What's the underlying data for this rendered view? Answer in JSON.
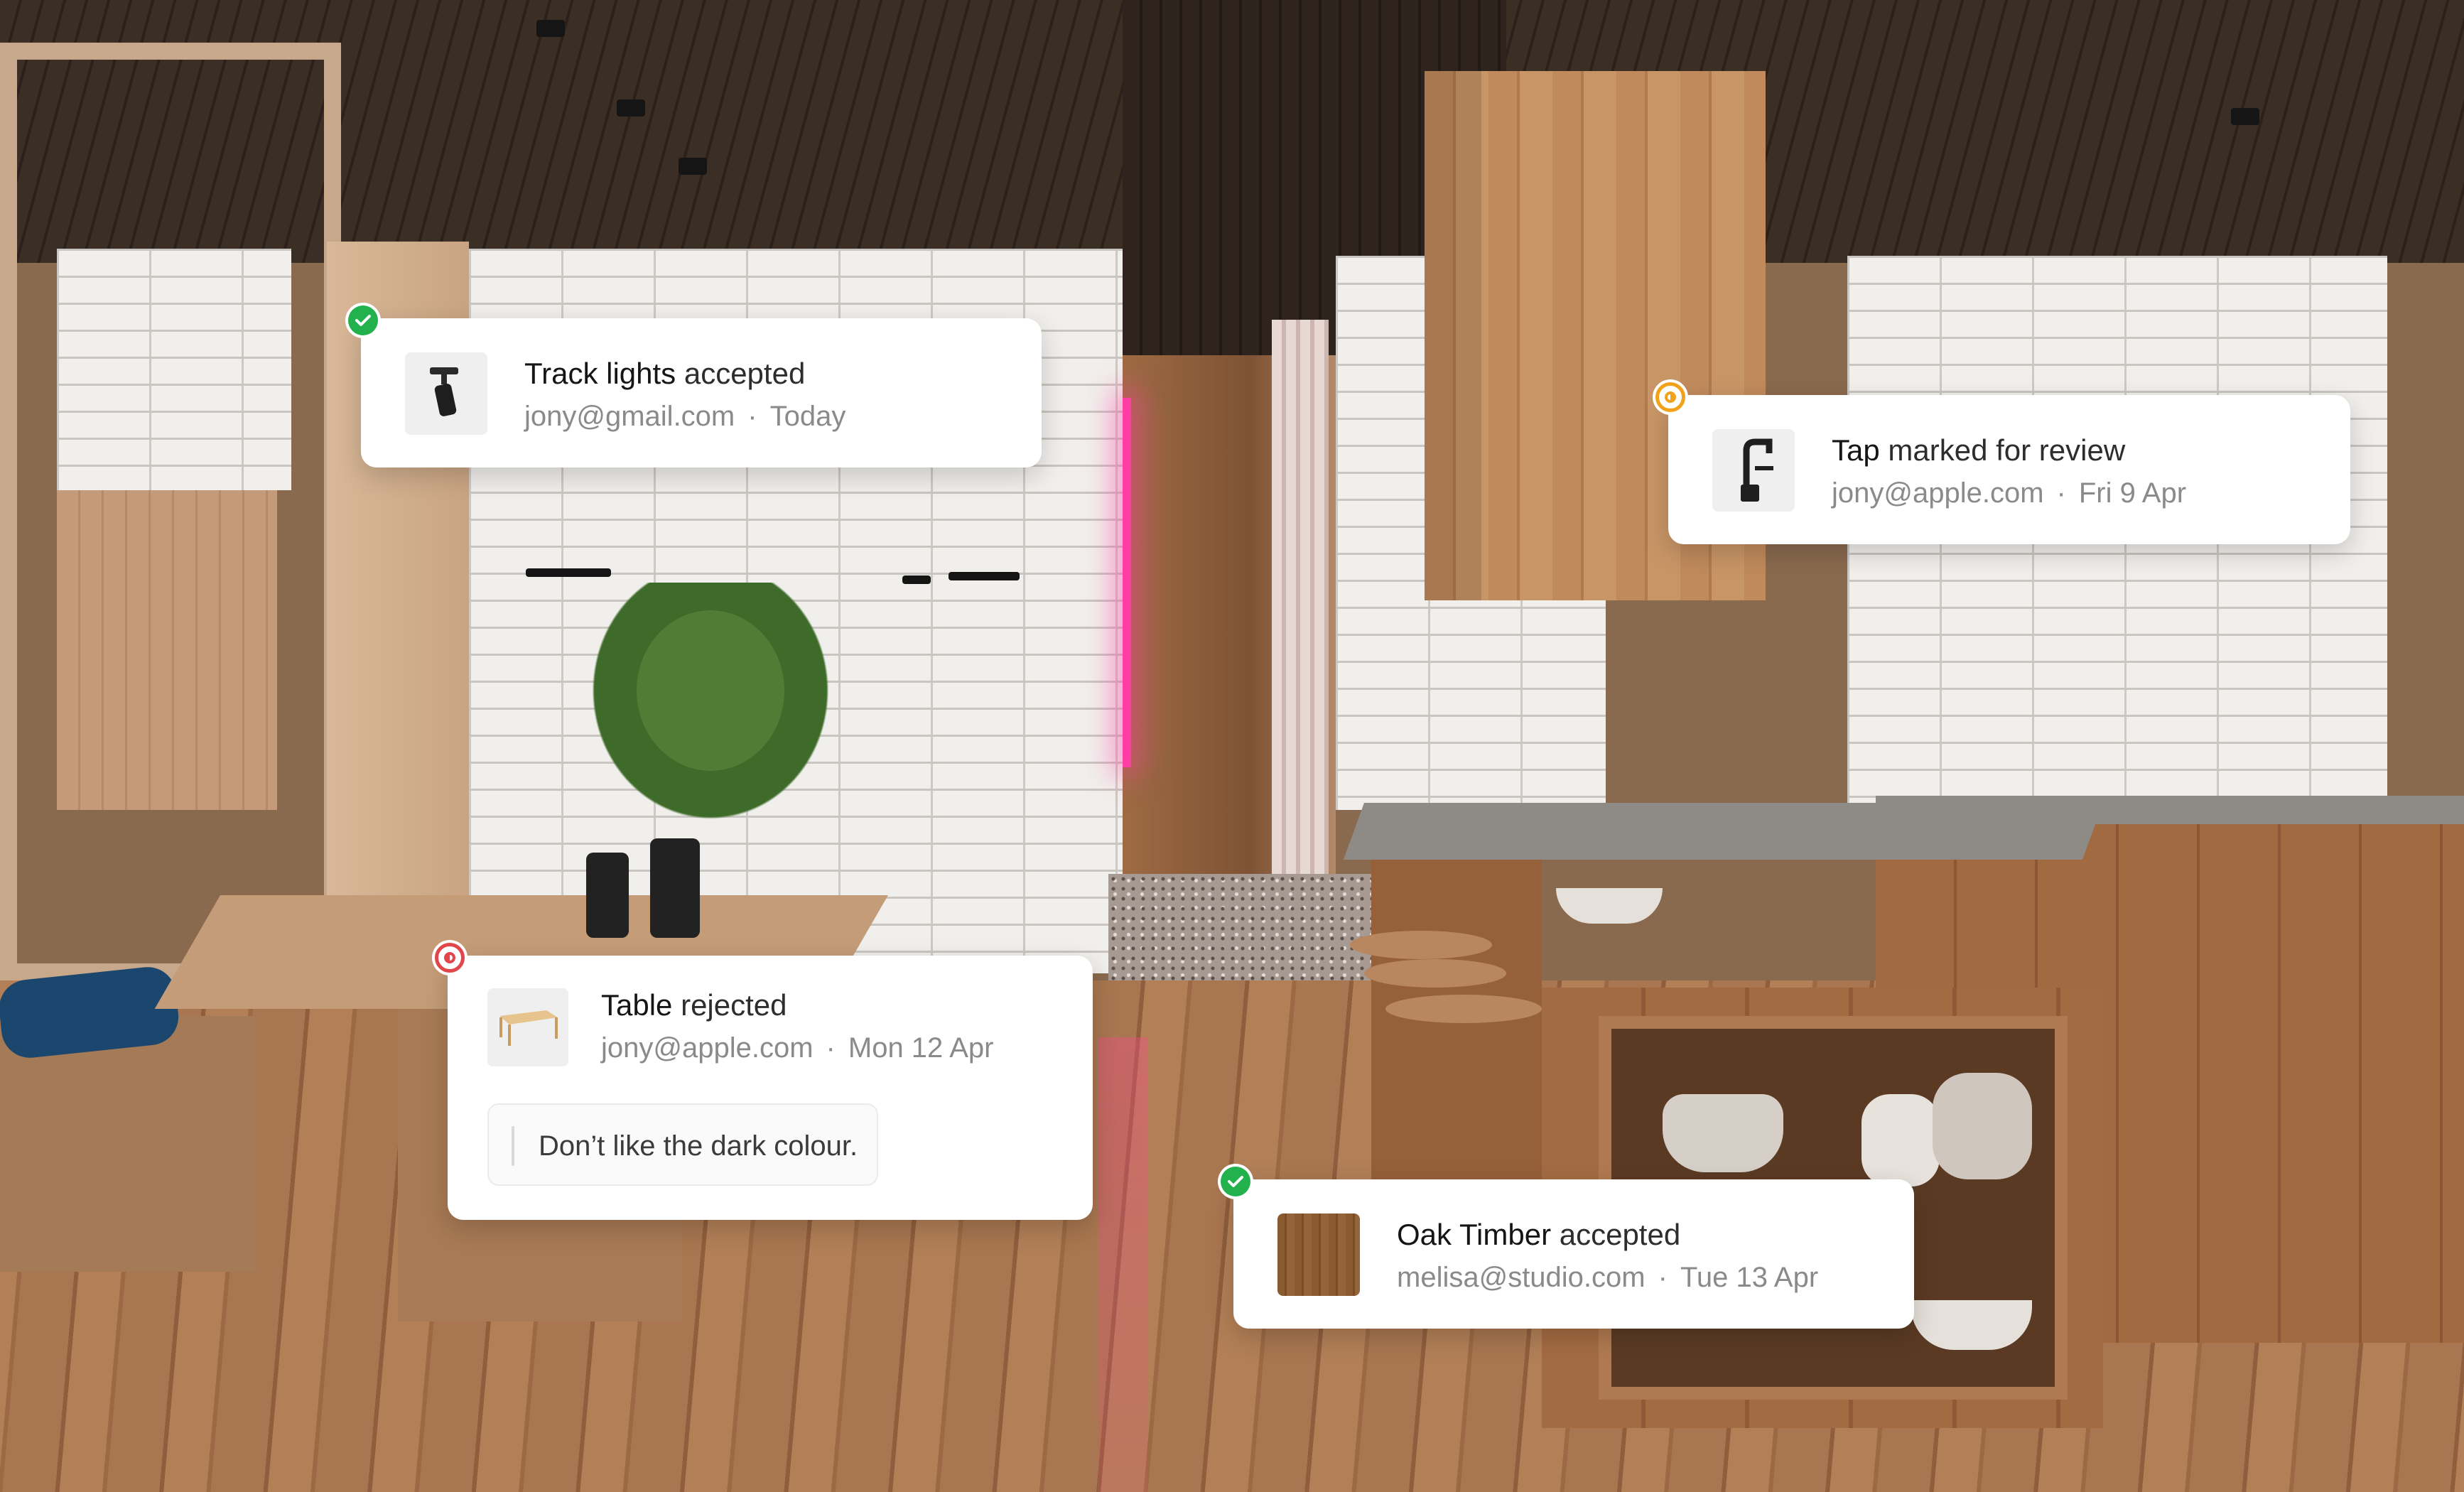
{
  "cards": [
    {
      "item": "Track lights",
      "action": "accepted",
      "user": "jony@gmail.com",
      "separator": "·",
      "time": "Today",
      "status": "accepted",
      "thumb_icon": "track-light-icon"
    },
    {
      "item": "Tap",
      "action": "marked for review",
      "user": "jony@apple.com",
      "separator": "·",
      "time": "Fri 9 Apr",
      "status": "review",
      "thumb_icon": "tap-icon"
    },
    {
      "item": "Table",
      "action": "rejected",
      "user": "jony@apple.com",
      "separator": "·",
      "time": "Mon 12 Apr",
      "status": "rejected",
      "thumb_icon": "table-icon",
      "comment": "Don’t like the dark colour."
    },
    {
      "item": "Oak Timber",
      "action": "accepted",
      "user": "melisa@studio.com",
      "separator": "·",
      "time": "Tue 13 Apr",
      "status": "accepted",
      "thumb_icon": "oak-timber-swatch"
    }
  ],
  "colors": {
    "accepted": "#22b14c",
    "review": "#f2a21a",
    "rejected": "#e0464a"
  }
}
